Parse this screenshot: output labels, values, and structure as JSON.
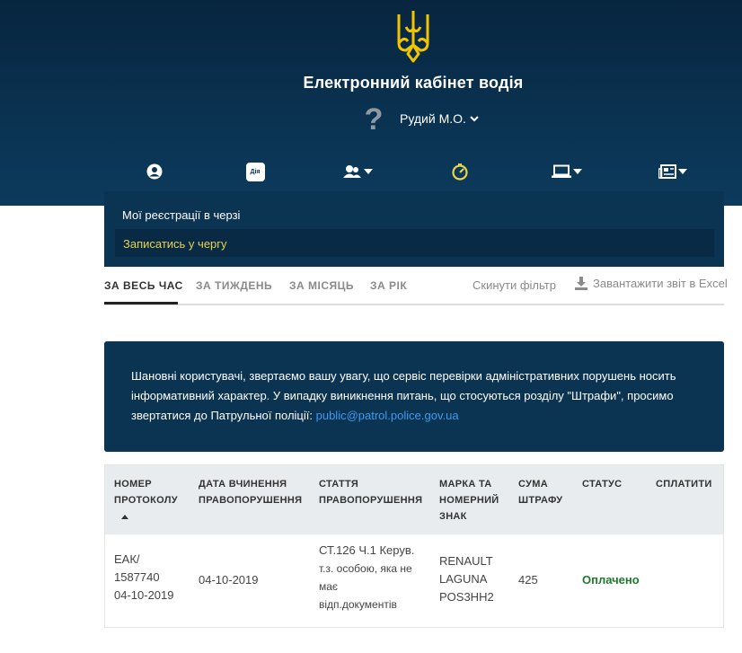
{
  "header": {
    "title": "Електронний кабінет водія",
    "user_name": "Рудий М.О.",
    "help_icon": "question-icon",
    "nav_icons": [
      "user-circle-icon",
      "diia-icon",
      "users-icon",
      "speedometer-icon",
      "laptop-icon",
      "newspaper-icon"
    ],
    "diia_label": "Дія"
  },
  "dropdown": {
    "item1": "Мої реєстрації в черзі",
    "item2": "Записатись у чергу"
  },
  "tabs": {
    "all_time": "ЗА ВЕСЬ ЧАС",
    "week": "ЗА ТИЖДЕНЬ",
    "month": "ЗА МІСЯЦЬ",
    "year": "ЗА РІК",
    "reset": "Скинути фільтр",
    "excel": "Завантажити звіт в Excel"
  },
  "notice": {
    "text": "Шановні користувачі, звертаємо вашу увагу, що сервіс перевірки адміністративних порушень носить інформативний характер. У випадку виникнення питань, що стосуються розділу \"Штрафи\", просимо звертатися до Патрульної поліції: ",
    "email": "public@patrol.police.gov.ua"
  },
  "table": {
    "headers": {
      "protocol": "НОМЕР ПРОТОКОЛУ",
      "date": "ДАТА ВЧИНЕННЯ ПРАВОПОРУШЕННЯ",
      "article": "СТАТТЯ ПРАВОПОРУШЕННЯ",
      "car": "МАРКА ТА НОМЕРНИЙ ЗНАК",
      "sum": "СУМА ШТРАФУ",
      "status": "СТАТУС",
      "pay": "СПЛАТИТИ"
    },
    "rows": [
      {
        "protocol_1": "ЕАК/",
        "protocol_2": "1587740",
        "protocol_3": "04-10-2019",
        "date": "04-10-2019",
        "article_1": "СТ.126 Ч.1 Керув.",
        "article_2": "т.з. особою, яка не",
        "article_3": "має",
        "article_4": "відп.документів",
        "car_1": "RENAULT",
        "car_2": "LAGUNA",
        "car_3": "POS3HH2",
        "sum": "425",
        "status": "Оплачено"
      }
    ]
  },
  "colors": {
    "header_bg": "#0a3352",
    "trident": "#f2c500",
    "accent_yellow": "#e6d44e",
    "link": "#3d9bf0",
    "status_paid": "#1d7a2d"
  }
}
